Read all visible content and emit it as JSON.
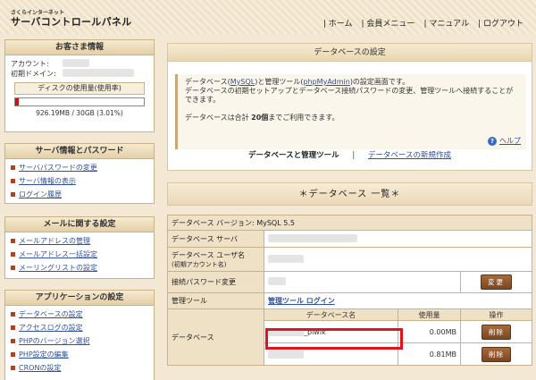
{
  "header": {
    "logo_small": "さくらインターネット",
    "logo_main": "サーバコントロールパネル",
    "nav": [
      "ホーム",
      "会員メニュー",
      "マニュアル",
      "ログアウト"
    ]
  },
  "sidebar": {
    "customer": {
      "title": "お客さま情報",
      "account_label": "アカウント:",
      "domain_label": "初期ドメイン:",
      "disk_label": "ディスクの使用量(使用率)",
      "disk_text": "926.19MB / 30GB (3.01%)",
      "disk_ratio": 0.0301
    },
    "server": {
      "title": "サーバ情報とパスワード",
      "items": [
        "サーバパスワードの変更",
        "サーバ情報の表示",
        "ログイン履歴"
      ]
    },
    "mail": {
      "title": "メールに関する設定",
      "items": [
        "メールアドレスの管理",
        "メールアドレス一括設定",
        "メーリングリストの設定"
      ]
    },
    "app": {
      "title": "アプリケーションの設定",
      "items": [
        "データベースの設定",
        "アクセスログの設定",
        "PHPのバージョン選択",
        "PHP設定の編集",
        "CRONの設定"
      ]
    }
  },
  "db_settings": {
    "title": "データベースの設定",
    "desc_line1_a": "データベース(",
    "desc_link_mysql": "MySQL",
    "desc_line1_b": ")と管理ツール(",
    "desc_link_pma": "phpMyAdmin",
    "desc_line1_c": ")の設定画面です。",
    "desc_line2": "データベースの初期セットアップとデータベース接続パスワードの変更、管理ツールへ接続することができます。",
    "desc_line3_a": "データベースは合計",
    "desc_line3_b": "20個",
    "desc_line3_c": "までご利用できます。",
    "help": "ヘルプ",
    "tab_active": "データベースと管理ツール",
    "tab_new": "データベースの新規作成"
  },
  "db_list": {
    "title": "＊データベース 一覧＊",
    "version_label": "データベース バージョン: MySQL 5.5",
    "server_label": "データベース サーバ",
    "user_label": "データベース ユーザ名",
    "user_sublabel": "(初期アカウント名)",
    "password_label": "接続パスワード変更",
    "change_button": "変更",
    "tool_label": "管理ツール",
    "tool_link": "管理ツール ログイン",
    "db_label": "データベース",
    "col_name": "データベース名",
    "col_usage": "使用量",
    "col_action": "操作",
    "rows": [
      {
        "name_suffix": "_piwik",
        "usage": "0.00MB",
        "action": "削除"
      },
      {
        "name_suffix": "",
        "usage": "0.81MB",
        "action": "削除"
      }
    ]
  }
}
